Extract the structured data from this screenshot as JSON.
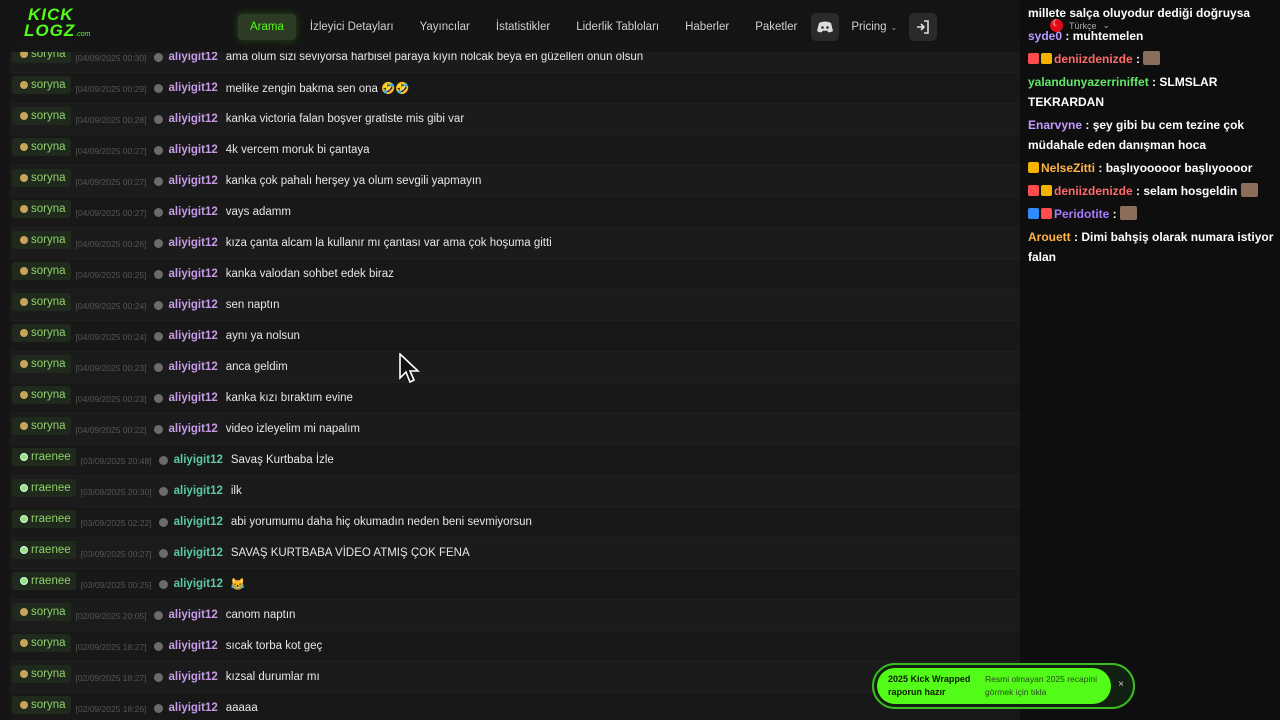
{
  "brand": {
    "logo_line1": "KICK",
    "logo_line2": "LOGZ",
    "logo_suffix": ".com",
    "accent": "#53fc18"
  },
  "nav": {
    "items": [
      "Arama",
      "İzleyici Detayları",
      "Yayıncılar",
      "İstatistikler",
      "Liderlik Tabloları",
      "Haberler",
      "Paketler"
    ],
    "active": "Arama",
    "discord_icon": "discord-icon",
    "pricing_label": "Pricing",
    "login_icon": "login-icon"
  },
  "language": {
    "label": "Türkçe"
  },
  "log_rows": [
    {
      "channel": "soryna",
      "time": "[04/09/2025 00:30]",
      "user": "aliyigit12",
      "user_color": "purple",
      "message": "ama olum sizi seviyorsa harbisel paraya kıyın nolcak beya en güzelleri onun olsun"
    },
    {
      "channel": "soryna",
      "time": "[04/09/2025 00:29]",
      "user": "aliyigit12",
      "user_color": "purple",
      "message": "melike zengin bakma sen ona 🤣🤣"
    },
    {
      "channel": "soryna",
      "time": "[04/09/2025 00:28]",
      "user": "aliyigit12",
      "user_color": "purple",
      "message": "kanka victoria falan boşver gratiste mis gibi var"
    },
    {
      "channel": "soryna",
      "time": "[04/09/2025 00:27]",
      "user": "aliyigit12",
      "user_color": "purple",
      "message": "4k vercem moruk bi çantaya"
    },
    {
      "channel": "soryna",
      "time": "[04/09/2025 00:27]",
      "user": "aliyigit12",
      "user_color": "purple",
      "message": "kanka çok pahalı herşey ya olum sevgili yapmayın"
    },
    {
      "channel": "soryna",
      "time": "[04/09/2025 00:27]",
      "user": "aliyigit12",
      "user_color": "purple",
      "message": "vays adamm"
    },
    {
      "channel": "soryna",
      "time": "[04/09/2025 00:26]",
      "user": "aliyigit12",
      "user_color": "purple",
      "message": "kıza çanta alcam la kullanır mı çantası var ama çok hoşuma gitti"
    },
    {
      "channel": "soryna",
      "time": "[04/09/2025 00:25]",
      "user": "aliyigit12",
      "user_color": "purple",
      "message": "kanka valodan sohbet edek biraz"
    },
    {
      "channel": "soryna",
      "time": "[04/09/2025 00:24]",
      "user": "aliyigit12",
      "user_color": "purple",
      "message": "sen naptın"
    },
    {
      "channel": "soryna",
      "time": "[04/09/2025 00:24]",
      "user": "aliyigit12",
      "user_color": "purple",
      "message": "aynı ya nolsun"
    },
    {
      "channel": "soryna",
      "time": "[04/09/2025 00:23]",
      "user": "aliyigit12",
      "user_color": "purple",
      "message": "anca geldim"
    },
    {
      "channel": "soryna",
      "time": "[04/09/2025 00:23]",
      "user": "aliyigit12",
      "user_color": "purple",
      "message": "kanka kızı bıraktım evine"
    },
    {
      "channel": "soryna",
      "time": "[04/09/2025 00:22]",
      "user": "aliyigit12",
      "user_color": "purple",
      "message": "video izleyelim mi napalım"
    },
    {
      "channel": "rraenee",
      "time": "[03/09/2025 20:48]",
      "user": "aliyigit12",
      "user_color": "teal",
      "message": "Savaş Kurtbaba İzle"
    },
    {
      "channel": "rraenee",
      "time": "[03/09/2025 20:30]",
      "user": "aliyigit12",
      "user_color": "teal",
      "message": "ilk"
    },
    {
      "channel": "rraenee",
      "time": "[03/09/2025 02:22]",
      "user": "aliyigit12",
      "user_color": "teal",
      "message": "abi yorumumu daha hiç okumadın neden beni sevmiyorsun"
    },
    {
      "channel": "rraenee",
      "time": "[03/09/2025 00:27]",
      "user": "aliyigit12",
      "user_color": "teal",
      "message": "SAVAŞ KURTBABA VİDEO ATMIŞ ÇOK FENA"
    },
    {
      "channel": "rraenee",
      "time": "[03/09/2025 00:25]",
      "user": "aliyigit12",
      "user_color": "teal",
      "message": "😹"
    },
    {
      "channel": "soryna",
      "time": "[02/09/2025 20:05]",
      "user": "aliyigit12",
      "user_color": "purple",
      "message": "canom naptın"
    },
    {
      "channel": "soryna",
      "time": "[02/09/2025 18:27]",
      "user": "aliyigit12",
      "user_color": "purple",
      "message": "sıcak torba kot geç"
    },
    {
      "channel": "soryna",
      "time": "[02/09/2025 18:27]",
      "user": "aliyigit12",
      "user_color": "purple",
      "message": "kızsal durumlar mı"
    },
    {
      "channel": "soryna",
      "time": "[02/09/2025 18:26]",
      "user": "aliyigit12",
      "user_color": "purple",
      "message": "aaaaa"
    }
  ],
  "stream_chat": [
    {
      "nick": "",
      "nick_color": "#ffffff",
      "text": "millete salça oluyodur dediği doğruysa"
    },
    {
      "nick": "syde0",
      "nick_color": "#b99cff",
      "text": "muhtemelen"
    },
    {
      "nick": "deniizdenizde",
      "nick_color": "#ff6a6a",
      "text": ""
    },
    {
      "nick": "yalandunyazerriniffet",
      "nick_color": "#61e86b",
      "text": "SLMSLAR TEKRARDAN"
    },
    {
      "nick": "Enarvyne",
      "nick_color": "#c49bff",
      "text": "şey gibi bu cem tezine çok müdahale eden danışman hoca"
    },
    {
      "nick": "NelseZitti",
      "nick_color": "#ffb347",
      "text": "başlıyooooor başlıyoooor"
    },
    {
      "nick": "deniizdenizde",
      "nick_color": "#ff6a6a",
      "text": "selam hosgeldin"
    },
    {
      "nick": "Peridotite",
      "nick_color": "#a77bff",
      "text": ""
    },
    {
      "nick": "Arouett",
      "nick_color": "#ffb347",
      "text": "Dimi bahşiş olarak numara istiyor falan"
    }
  ],
  "promo": {
    "title": "2025 Kick Wrapped raporun hazır",
    "subtitle": "Resmi olmayan 2025 recapini görmek için tıkla",
    "close": "×"
  }
}
